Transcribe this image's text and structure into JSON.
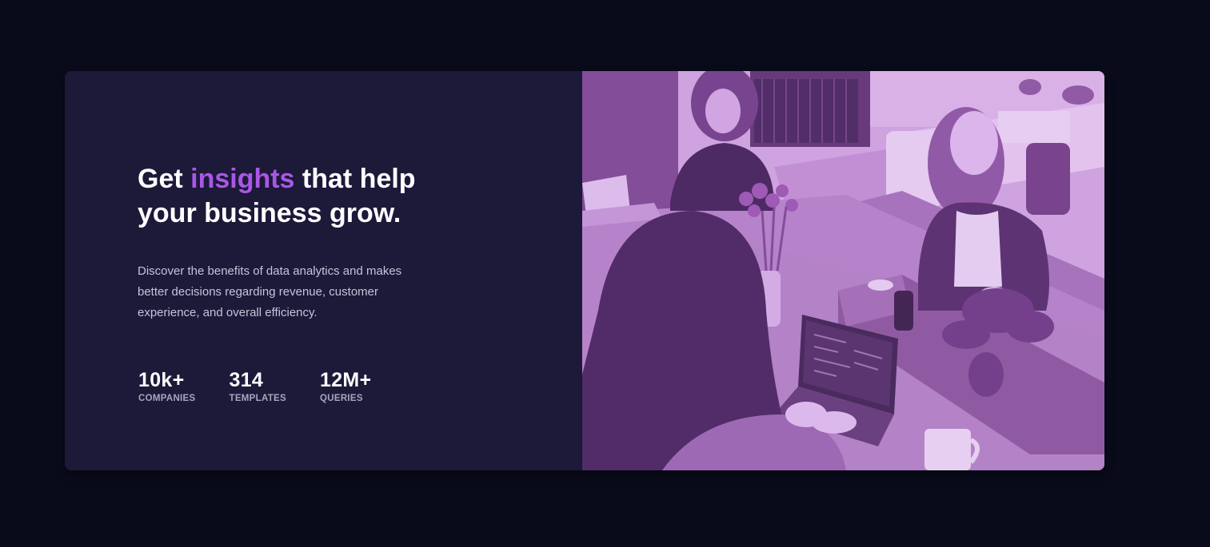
{
  "hero": {
    "headline": {
      "before": "Get ",
      "accent": "insights",
      "after": " that help your business grow."
    },
    "description": "Discover the benefits of data analytics and makes better decisions regarding revenue, customer experience, and overall efficiency.",
    "stats": [
      {
        "value": "10k+",
        "label": "COMPANIES"
      },
      {
        "value": "314",
        "label": "TEMPLATES"
      },
      {
        "value": "12M+",
        "label": "QUERIES"
      }
    ]
  },
  "colors": {
    "background": "#090b1a",
    "card": "#1c1939",
    "accent": "#a957e6",
    "photo_overlay": "#aa5cdb"
  }
}
